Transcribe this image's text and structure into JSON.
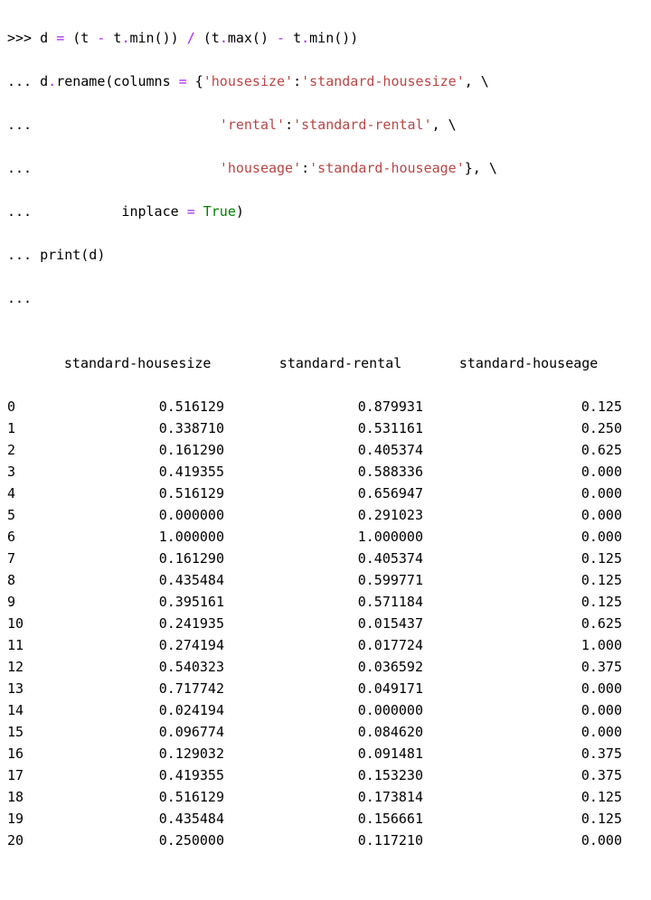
{
  "prompts": {
    "primary": ">>>",
    "continuation": "..."
  },
  "code": {
    "line1_a": " d ",
    "line1_eq": "=",
    "line1_b": " (t ",
    "line1_minus1": "-",
    "line1_c": " t",
    "line1_dot1": ".",
    "line1_min": "min()) ",
    "line1_div": "/",
    "line1_d": " (t",
    "line1_dot2": ".",
    "line1_max": "max() ",
    "line1_minus2": "-",
    "line1_e": " t",
    "line1_dot3": ".",
    "line1_min2": "min())",
    "line2_a": " d",
    "line2_dot": ".",
    "line2_b": "rename(columns ",
    "line2_eq": "=",
    "line2_c": " {",
    "line2_s1": "'housesize'",
    "line2_colon1": ":",
    "line2_s2": "'standard-housesize'",
    "line2_d": ", \\",
    "line3_pad": "                       ",
    "line3_s1": "'rental'",
    "line3_colon": ":",
    "line3_s2": "'standard-rental'",
    "line3_end": ", \\",
    "line4_pad": "                       ",
    "line4_s1": "'houseage'",
    "line4_colon": ":",
    "line4_s2": "'standard-houseage'",
    "line4_end": "}, \\",
    "line5_pad": "           inplace ",
    "line5_eq": "=",
    "line5_sp": " ",
    "line5_true": "True",
    "line5_end": ")",
    "line6": " print(d)"
  },
  "table": {
    "headers": [
      "standard-housesize",
      "standard-rental",
      "standard-houseage"
    ],
    "index": [
      "0",
      "1",
      "2",
      "3",
      "4",
      "5",
      "6",
      "7",
      "8",
      "9",
      "10",
      "11",
      "12",
      "13",
      "14",
      "15",
      "16",
      "17",
      "18",
      "19",
      "20"
    ],
    "columns": {
      "standard_housesize": [
        "0.516129",
        "0.338710",
        "0.161290",
        "0.419355",
        "0.516129",
        "0.000000",
        "1.000000",
        "0.161290",
        "0.435484",
        "0.395161",
        "0.241935",
        "0.274194",
        "0.540323",
        "0.717742",
        "0.024194",
        "0.096774",
        "0.129032",
        "0.419355",
        "0.516129",
        "0.435484",
        "0.250000"
      ],
      "standard_rental": [
        "0.879931",
        "0.531161",
        "0.405374",
        "0.588336",
        "0.656947",
        "0.291023",
        "1.000000",
        "0.405374",
        "0.599771",
        "0.571184",
        "0.015437",
        "0.017724",
        "0.036592",
        "0.049171",
        "0.000000",
        "0.084620",
        "0.091481",
        "0.153230",
        "0.173814",
        "0.156661",
        "0.117210"
      ],
      "standard_houseage": [
        "0.125",
        "0.250",
        "0.625",
        "0.000",
        "0.000",
        "0.000",
        "0.000",
        "0.125",
        "0.125",
        "0.125",
        "0.625",
        "1.000",
        "0.375",
        "0.000",
        "0.000",
        "0.000",
        "0.375",
        "0.375",
        "0.125",
        "0.125",
        "0.000"
      ]
    }
  },
  "chart_data": {
    "type": "table",
    "title": "",
    "columns": [
      "standard-housesize",
      "standard-rental",
      "standard-houseage"
    ],
    "index": [
      0,
      1,
      2,
      3,
      4,
      5,
      6,
      7,
      8,
      9,
      10,
      11,
      12,
      13,
      14,
      15,
      16,
      17,
      18,
      19,
      20
    ],
    "data": [
      [
        0.516129,
        0.879931,
        0.125
      ],
      [
        0.33871,
        0.531161,
        0.25
      ],
      [
        0.16129,
        0.405374,
        0.625
      ],
      [
        0.419355,
        0.588336,
        0.0
      ],
      [
        0.516129,
        0.656947,
        0.0
      ],
      [
        0.0,
        0.291023,
        0.0
      ],
      [
        1.0,
        1.0,
        0.0
      ],
      [
        0.16129,
        0.405374,
        0.125
      ],
      [
        0.435484,
        0.599771,
        0.125
      ],
      [
        0.395161,
        0.571184,
        0.125
      ],
      [
        0.241935,
        0.015437,
        0.625
      ],
      [
        0.274194,
        0.017724,
        1.0
      ],
      [
        0.540323,
        0.036592,
        0.375
      ],
      [
        0.717742,
        0.049171,
        0.0
      ],
      [
        0.024194,
        0.0,
        0.0
      ],
      [
        0.096774,
        0.08462,
        0.0
      ],
      [
        0.129032,
        0.091481,
        0.375
      ],
      [
        0.419355,
        0.15323,
        0.375
      ],
      [
        0.516129,
        0.173814,
        0.125
      ],
      [
        0.435484,
        0.156661,
        0.125
      ],
      [
        0.25,
        0.11721,
        0.0
      ]
    ]
  }
}
